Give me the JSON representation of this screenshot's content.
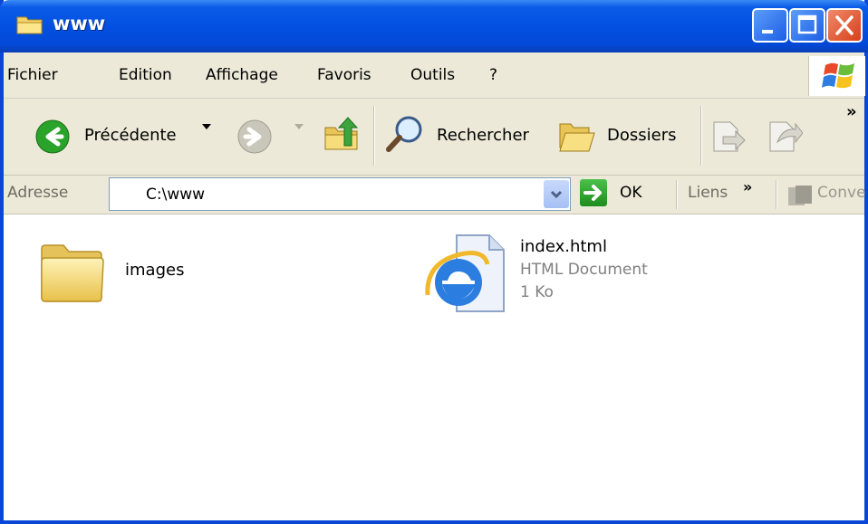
{
  "window": {
    "title": "www"
  },
  "menu": {
    "items": [
      "Fichier",
      "Edition",
      "Affichage",
      "Favoris",
      "Outils",
      "?"
    ]
  },
  "toolbar": {
    "back_label": "Précédente",
    "search_label": "Rechercher",
    "folders_label": "Dossiers",
    "more_chevron": "»"
  },
  "address": {
    "label": "Adresse",
    "value": "C:\\www",
    "go_label": "OK",
    "links_label": "Liens",
    "links_chevron": "»",
    "convert_label": "Conve"
  },
  "files": [
    {
      "name": "images",
      "icon": "folder-icon"
    },
    {
      "name": "index.html",
      "type": "HTML Document",
      "size": "1 Ko",
      "icon": "internet-explorer-icon"
    }
  ],
  "colors": {
    "titlebar": "#0350e0",
    "chrome": "#ece9d8",
    "close": "#d6401a"
  }
}
